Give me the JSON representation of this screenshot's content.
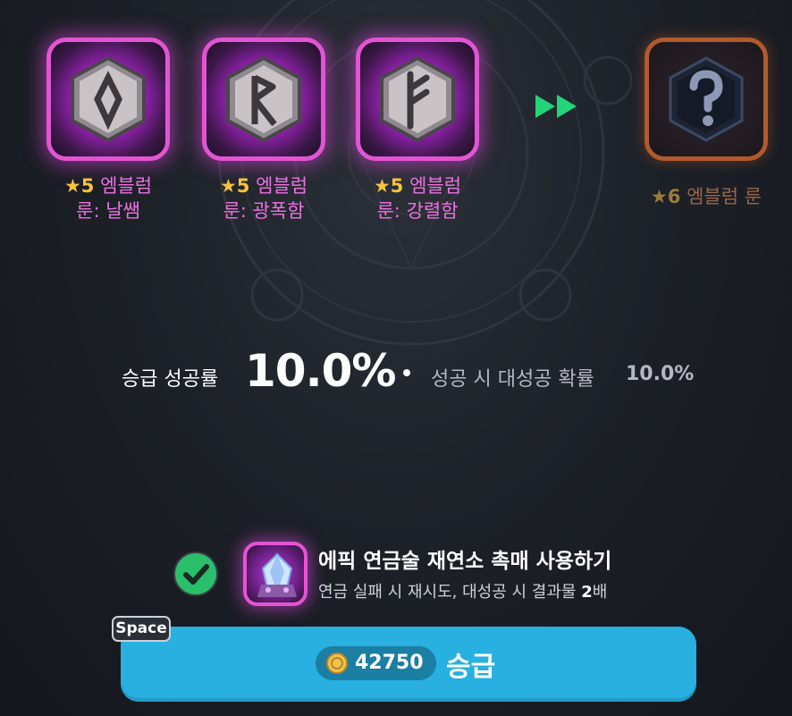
{
  "runes": [
    {
      "star": "★5",
      "name_line1": "엠블럼",
      "name_line2": "룬: 날쌤",
      "icon": "rune-diamond-icon"
    },
    {
      "star": "★5",
      "name_line1": "엠블럼",
      "name_line2": "룬: 광폭함",
      "icon": "rune-r-icon"
    },
    {
      "star": "★5",
      "name_line1": "엠블럼",
      "name_line2": "룬: 강렬함",
      "icon": "rune-f-icon"
    }
  ],
  "result": {
    "star": "★6",
    "name": "엠블럼 룬",
    "icon": "question-mark-icon"
  },
  "rate": {
    "label": "승급 성공률",
    "value": "10.0%",
    "sub_label": "성공 시 대성공 확률",
    "sub_value": "10.0%"
  },
  "catalyst": {
    "checked": true,
    "title": "에픽 연금술 재연소 촉매 사용하기",
    "desc_prefix": "연금 실패 시 재시도, 대성공 시 결과물",
    "desc_mult": "2",
    "desc_suffix": "배"
  },
  "upgrade_button": {
    "hotkey": "Space",
    "cost": "42750",
    "label": "승급"
  },
  "colors": {
    "rune_glow": "#e354d4",
    "result_frame": "#b25a2c",
    "button": "#27b0e0",
    "arrow": "#22d47a",
    "check": "#2bbf6c"
  }
}
